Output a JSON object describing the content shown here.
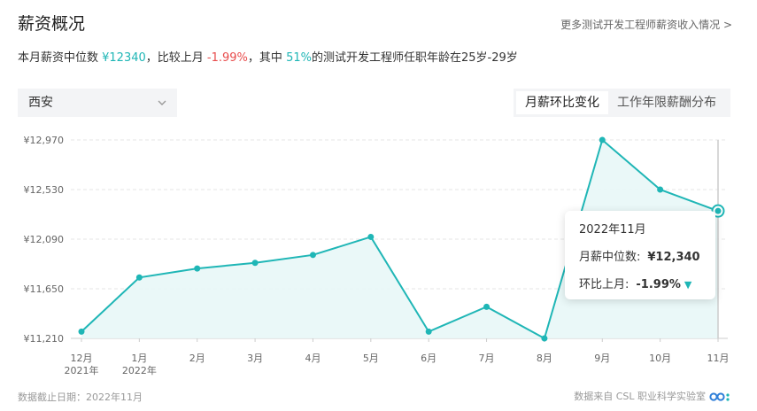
{
  "header": {
    "title": "薪资概况",
    "more_link": "更多测试开发工程师薪资收入情况 >"
  },
  "summary": {
    "p1": "本月薪资中位数 ",
    "median": "¥12340",
    "p2": "，比较上月 ",
    "change": "-1.99%",
    "p3": "，其中 ",
    "share": "51%",
    "p4": "的测试开发工程师任职年龄在25岁-29岁"
  },
  "controls": {
    "city": "西安",
    "tabs": [
      "月薪环比变化",
      "工作年限薪酬分布"
    ],
    "active_tab": 0
  },
  "tooltip": {
    "date": "2022年11月",
    "median_label": "月薪中位数:",
    "median_value": "¥12,340",
    "mom_label": "环比上月:",
    "mom_value": "-1.99%",
    "arrow": "▼"
  },
  "footer": {
    "date_text": "数据截止日期：2022年11月",
    "source_text": "数据来自 CSL 职业科学实验室"
  },
  "colors": {
    "line": "#1fb6b6",
    "area": "#e8f7f7",
    "negative": "#e84c4c",
    "grid": "#e6e6e6"
  },
  "chart_data": {
    "type": "area",
    "x": [
      "12月",
      "1月",
      "2月",
      "3月",
      "4月",
      "5月",
      "6月",
      "7月",
      "8月",
      "9月",
      "10月",
      "11月"
    ],
    "x_sublabels": [
      "2021年",
      "2022年",
      "",
      "",
      "",
      "",
      "",
      "",
      "",
      "",
      "",
      ""
    ],
    "series": [
      {
        "values": [
          11270,
          11750,
          11830,
          11880,
          11950,
          12110,
          11270,
          11490,
          11210,
          12970,
          12530,
          12340
        ]
      }
    ],
    "yticks": [
      "¥12,970",
      "¥12,530",
      "¥12,090",
      "¥11,650",
      "¥11,210"
    ],
    "ylim": [
      11210,
      12970
    ],
    "grid": true,
    "highlight_index": 11
  }
}
